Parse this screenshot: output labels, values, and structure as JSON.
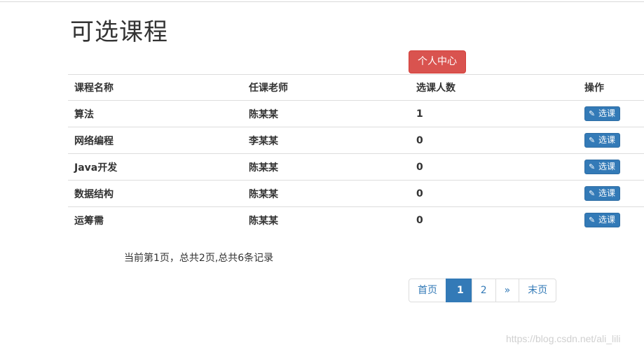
{
  "page": {
    "title": "可选课程",
    "personal_center_label": "个人中心"
  },
  "table": {
    "headers": {
      "name": "课程名称",
      "teacher": "任课老师",
      "count": "选课人数",
      "op": "操作"
    },
    "select_label": "选课",
    "select_icon": "pencil-icon",
    "rows": [
      {
        "name": "算法",
        "teacher": "陈某某",
        "count": "1"
      },
      {
        "name": "网络编程",
        "teacher": "李某某",
        "count": "0"
      },
      {
        "name": "Java开发",
        "teacher": "陈某某",
        "count": "0"
      },
      {
        "name": "数据结构",
        "teacher": "陈某某",
        "count": "0"
      },
      {
        "name": "运筹需",
        "teacher": "陈某某",
        "count": "0"
      }
    ]
  },
  "records_text": "当前第1页，总共2页,总共6条记录",
  "pagination": {
    "first": "首页",
    "pages": [
      "1",
      "2"
    ],
    "active_page": "1",
    "next": "»",
    "last": "末页"
  },
  "watermark": "https://blog.csdn.net/ali_lili",
  "colors": {
    "danger": "#d9534f",
    "primary": "#337ab7"
  }
}
